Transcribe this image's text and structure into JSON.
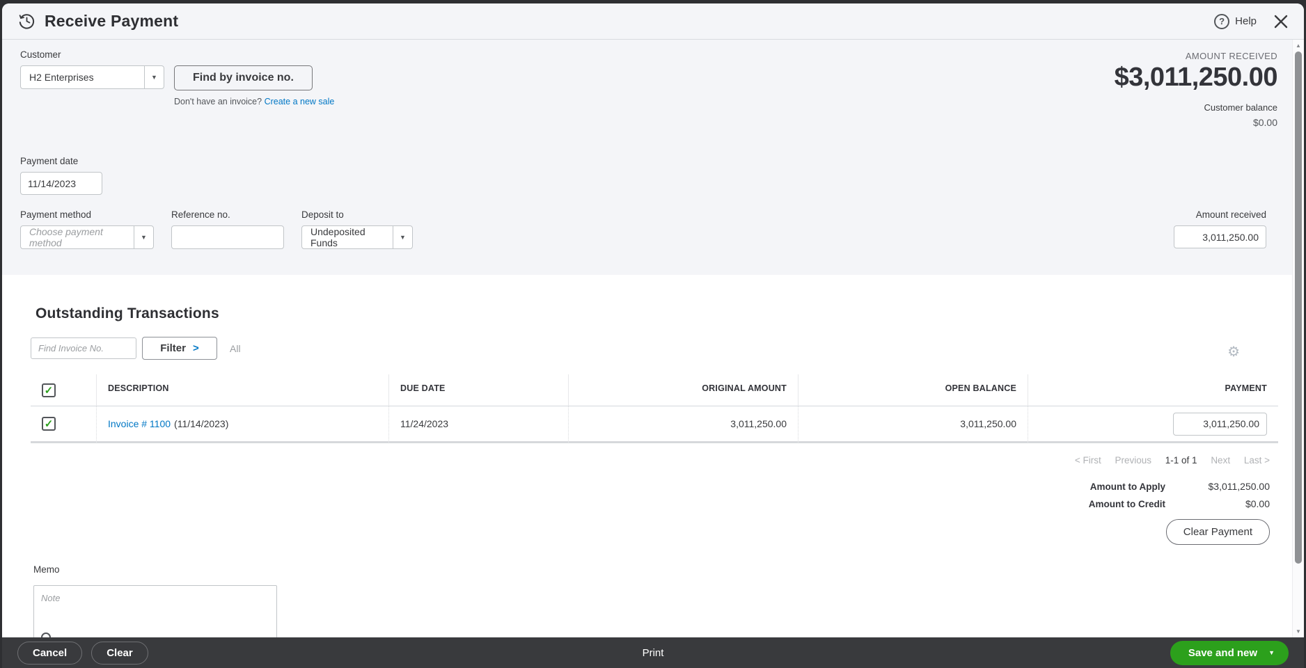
{
  "header": {
    "title": "Receive Payment",
    "help_label": "Help",
    "help_glyph": "?"
  },
  "summary": {
    "amount_received_label": "AMOUNT RECEIVED",
    "amount_received": "$3,011,250.00",
    "customer_balance_label": "Customer balance",
    "customer_balance": "$0.00"
  },
  "form": {
    "customer_label": "Customer",
    "customer_value": "H2 Enterprises",
    "find_by_invoice_label": "Find by invoice no.",
    "no_invoice_text": "Don't have an invoice?",
    "create_new_sale_label": "Create a new sale",
    "payment_date_label": "Payment date",
    "payment_date_value": "11/14/2023",
    "payment_method_label": "Payment method",
    "payment_method_placeholder": "Choose payment method",
    "reference_label": "Reference no.",
    "reference_value": "",
    "deposit_to_label": "Deposit to",
    "deposit_to_value": "Undeposited Funds",
    "amount_received_input_label": "Amount received",
    "amount_received_input_value": "3,011,250.00"
  },
  "transactions": {
    "title": "Outstanding Transactions",
    "find_invoice_placeholder": "Find Invoice No.",
    "filter_label": "Filter",
    "filter_status": "All",
    "columns": {
      "description": "DESCRIPTION",
      "due_date": "DUE DATE",
      "original_amount": "ORIGINAL AMOUNT",
      "open_balance": "OPEN BALANCE",
      "payment": "PAYMENT"
    },
    "rows": [
      {
        "checked": true,
        "description_link": "Invoice # 1100",
        "description_date": "(11/14/2023)",
        "due_date": "11/24/2023",
        "original_amount": "3,011,250.00",
        "open_balance": "3,011,250.00",
        "payment": "3,011,250.00"
      }
    ],
    "pagination": {
      "first": "< First",
      "previous": "Previous",
      "range": "1-1 of 1",
      "next": "Next",
      "last": "Last >"
    }
  },
  "totals": {
    "amount_to_apply_label": "Amount to Apply",
    "amount_to_apply": "$3,011,250.00",
    "amount_to_credit_label": "Amount to Credit",
    "amount_to_credit": "$0.00",
    "clear_payment_label": "Clear Payment"
  },
  "memo": {
    "label": "Memo",
    "placeholder": "Note"
  },
  "footer": {
    "cancel": "Cancel",
    "clear": "Clear",
    "print": "Print",
    "save_and_new": "Save and new"
  },
  "icons": {
    "dropdown": "▼",
    "check": "✓",
    "gear": "⚙",
    "up": "▲",
    "down": "▼",
    "chevron": ">"
  },
  "colors": {
    "accent_green": "#2ca01c",
    "link_blue": "#0077c5",
    "footer_dark": "#393a3d",
    "section_grey": "#f4f5f8"
  }
}
